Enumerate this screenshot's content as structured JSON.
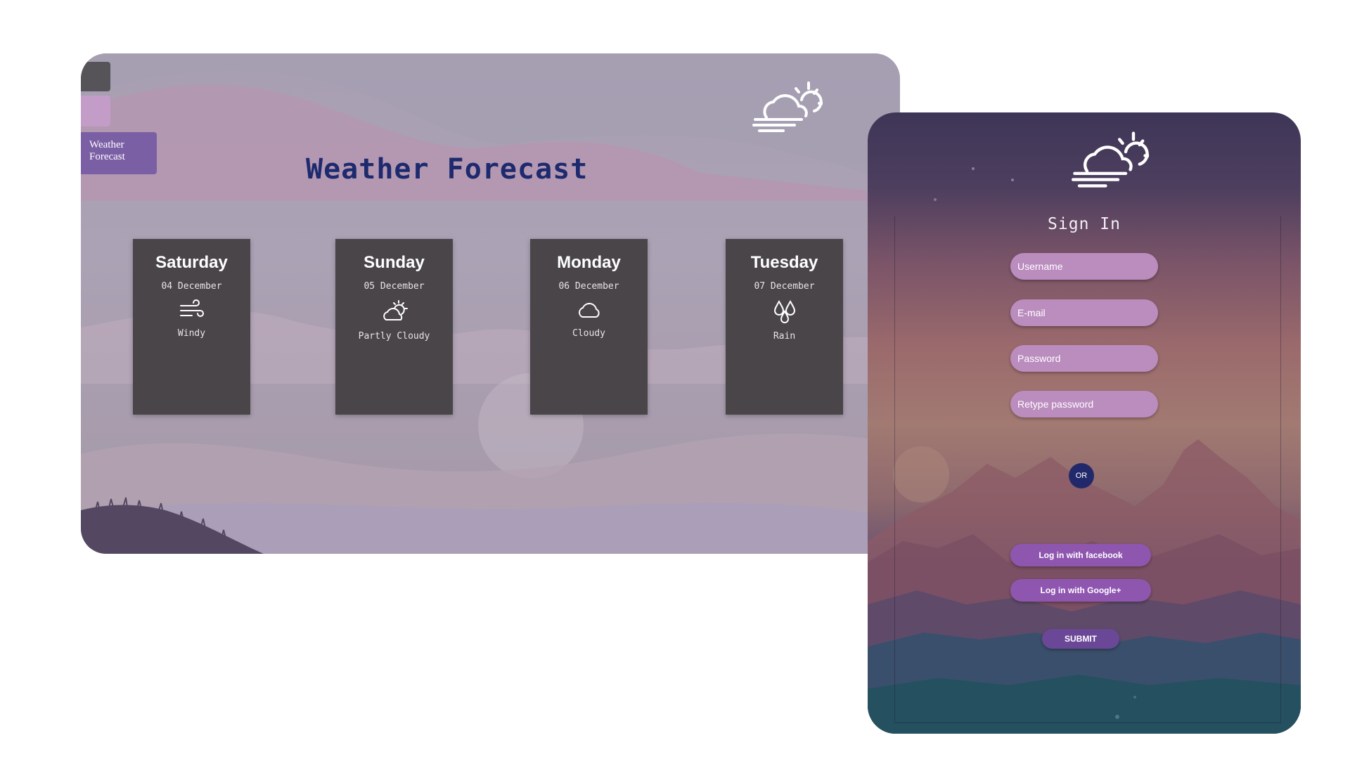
{
  "forecast": {
    "nav_label": "Weather Forecast",
    "title": "Weather Forecast",
    "days": [
      {
        "name": "Saturday",
        "date": "04 December",
        "icon": "wind-icon",
        "condition": "Windy"
      },
      {
        "name": "Sunday",
        "date": "05 December",
        "icon": "partly-cloudy-icon",
        "condition": "Partly Cloudy"
      },
      {
        "name": "Monday",
        "date": "06 December",
        "icon": "cloud-icon",
        "condition": "Cloudy"
      },
      {
        "name": "Tuesday",
        "date": "07 December",
        "icon": "rain-icon",
        "condition": "Rain"
      }
    ]
  },
  "signin": {
    "title": "Sign In",
    "fields": {
      "username_placeholder": "Username",
      "email_placeholder": "E-mail",
      "password_placeholder": "Password",
      "retype_placeholder": "Retype password"
    },
    "or_label": "OR",
    "facebook_label": "Log in with facebook",
    "google_label": "Log in with Google+",
    "submit_label": "SUBMIT"
  },
  "colors": {
    "title_blue": "#1d2a6e",
    "card_bg": "#4a4549",
    "input_pink": "#bb8cbe",
    "button_purple": "#8f56b0",
    "submit_purple": "#6a4897",
    "or_navy": "#22296a"
  }
}
